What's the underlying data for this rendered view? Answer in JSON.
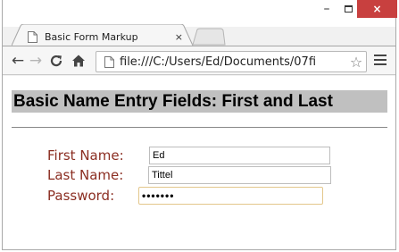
{
  "browser": {
    "tab_title": "Basic Form Markup",
    "tab_close": "×",
    "window_minimize": "–",
    "window_close": "×",
    "url": "file:///C:/Users/Ed/Documents/07fi"
  },
  "page": {
    "heading": "Basic Name Entry Fields: First and Last",
    "form": {
      "first_name_label": "First Name:",
      "first_name_value": "Ed",
      "last_name_label": "Last Name:",
      "last_name_value": "Tittel",
      "password_label": "Password:",
      "password_value": "•••••••"
    }
  },
  "colors": {
    "label": "#8b2e22",
    "heading_bg": "#c0c0c0",
    "close_button": "#c8403f"
  }
}
